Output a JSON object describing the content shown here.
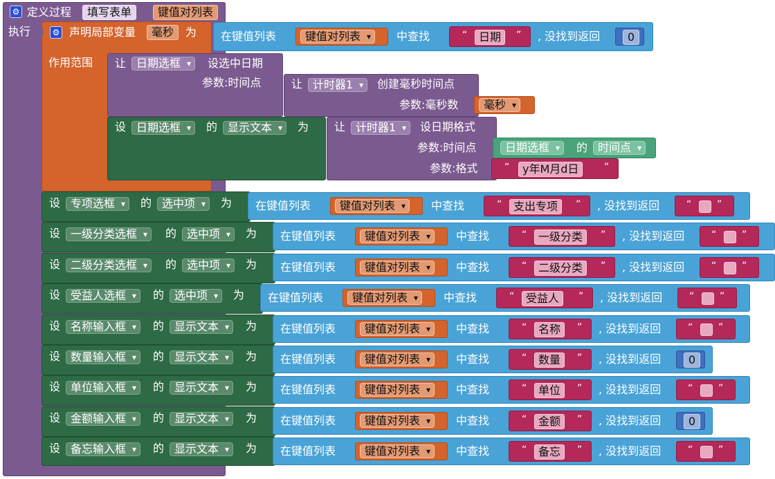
{
  "procedure": {
    "define_label": "定义过程",
    "name": "填写表单",
    "param": "键值对列表",
    "do_label": "执行"
  },
  "local_var": {
    "declare_label": "声明局部变量",
    "name": "毫秒",
    "as_label": "为",
    "scope_label": "作用范围"
  },
  "lookup": {
    "in_list_label": "在键值列表",
    "find_label": "中查找",
    "not_found_label": ", 没找到返回",
    "list_var": "键值对列表",
    "quote_open": "“",
    "quote_close": "”"
  },
  "first_lookup": {
    "key": "日期",
    "default": "0"
  },
  "set_date_block": {
    "let_label": "让",
    "component": "日期选框",
    "method": "设选中日期",
    "param_label": "参数:时间点",
    "inner_let": "让",
    "timer": "计时器1",
    "timer_method": "创建毫秒时间点",
    "inner_param_label": "参数:毫秒数",
    "inner_var": "毫秒"
  },
  "set_text_block": {
    "set_label": "设",
    "component": "日期选框",
    "of_label": "的",
    "property": "显示文本",
    "as_label": "为",
    "inner_let": "让",
    "timer": "计时器1",
    "timer_method": "设日期格式",
    "param_time_label": "参数:时间点",
    "time_component": "日期选框",
    "time_of": "的",
    "time_property": "时间点",
    "param_format_label": "参数:格式",
    "format": "y年M月d日"
  },
  "setters": [
    {
      "set": "设",
      "component": "专项选框",
      "of": "的",
      "property": "选中项",
      "as": "为",
      "key": "支出专项",
      "default": ""
    },
    {
      "set": "设",
      "component": "一级分类选框",
      "of": "的",
      "property": "选中项",
      "as": "为",
      "key": "一级分类",
      "default": ""
    },
    {
      "set": "设",
      "component": "二级分类选框",
      "of": "的",
      "property": "选中项",
      "as": "为",
      "key": "二级分类",
      "default": ""
    },
    {
      "set": "设",
      "component": "受益人选框",
      "of": "的",
      "property": "选中项",
      "as": "为",
      "key": "受益人",
      "default": ""
    },
    {
      "set": "设",
      "component": "名称输入框",
      "of": "的",
      "property": "显示文本",
      "as": "为",
      "key": "名称",
      "default": ""
    },
    {
      "set": "设",
      "component": "数量输入框",
      "of": "的",
      "property": "显示文本",
      "as": "为",
      "key": "数量",
      "default": "0"
    },
    {
      "set": "设",
      "component": "单位输入框",
      "of": "的",
      "property": "显示文本",
      "as": "为",
      "key": "单位",
      "default": ""
    },
    {
      "set": "设",
      "component": "金额输入框",
      "of": "的",
      "property": "显示文本",
      "as": "为",
      "key": "金额",
      "default": "0"
    },
    {
      "set": "设",
      "component": "备忘输入框",
      "of": "的",
      "property": "显示文本",
      "as": "为",
      "key": "备忘",
      "default": ""
    }
  ],
  "colors": {
    "procedure": "#7b5a90",
    "variable": "#d4632c",
    "setter": "#2d6a45",
    "dictionary": "#4aa3d7",
    "text": "#b4295a",
    "number": "#3f6fbd"
  },
  "icons": {
    "gear": "gear-icon"
  }
}
